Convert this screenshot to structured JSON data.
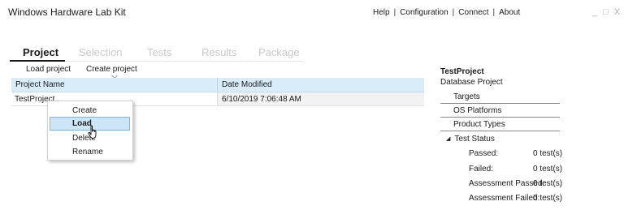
{
  "app": {
    "title": "Windows Hardware Lab Kit",
    "nav": [
      "Help",
      "Configuration",
      "Connect",
      "About"
    ],
    "window_controls": "_ □ X"
  },
  "tabs": [
    "Project",
    "Selection",
    "Tests",
    "Results",
    "Package"
  ],
  "toolbar": {
    "load_label": "Load project",
    "create_label": "Create project"
  },
  "grid": {
    "columns": [
      "Project Name",
      "Date Modified"
    ],
    "rows": [
      {
        "name": "TestProject",
        "date": "6/10/2019 7:06:48 AM"
      }
    ]
  },
  "context_menu": {
    "items": [
      "Create",
      "Load",
      "Delete",
      "Rename"
    ],
    "highlighted": "Load"
  },
  "details": {
    "name": "TestProject",
    "subtitle": "Database Project",
    "links": [
      "Targets",
      "OS Platforms",
      "Product Types"
    ],
    "status_header": "Test Status",
    "stats": [
      {
        "label": "Passed:",
        "value": "0 test(s)"
      },
      {
        "label": "Failed:",
        "value": "0 test(s)"
      },
      {
        "label": "Assessment Passed:",
        "value": "0 test(s)"
      },
      {
        "label": "Assessment Failed:",
        "value": "0 test(s)"
      }
    ]
  }
}
